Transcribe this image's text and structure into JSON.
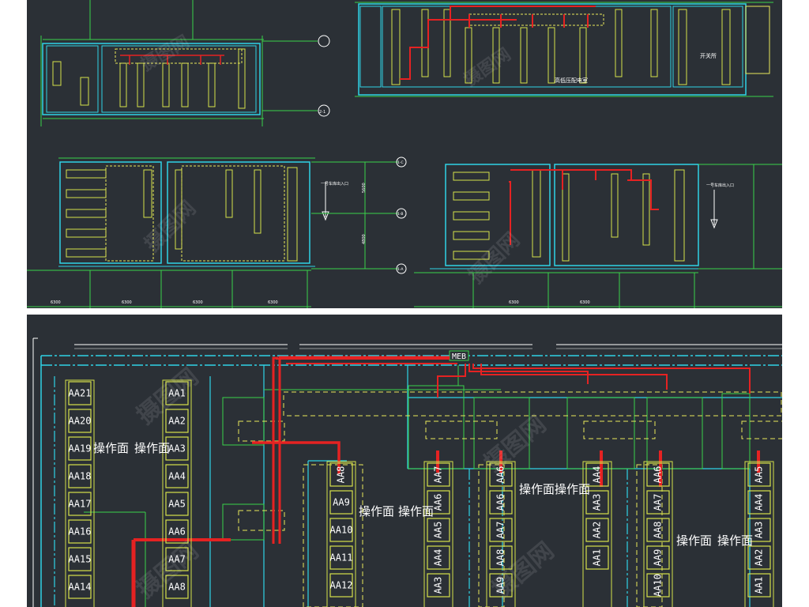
{
  "colors": {
    "background": "#2b3036",
    "wall": "#2fd3e6",
    "cabinet": "#d6e24a",
    "cable_tray": "#e52222",
    "dimension": "#39d24a",
    "dashed": "#e8e85a",
    "text": "#ffffff"
  },
  "top": {
    "axis_labels": [
      "2-1",
      "1-C",
      "1-B",
      "1-A"
    ],
    "dimension_labels": [
      "5600",
      "4800"
    ],
    "room_labels": [
      "高低压配电室",
      "开关所",
      "操作面"
    ],
    "entrance_labels": [
      "一号车库出入口",
      "一号车库出入口"
    ],
    "bottom_dimensions": [
      "6300",
      "6300",
      "6300",
      "6300",
      "6300",
      "6300"
    ]
  },
  "bottom": {
    "meb_label": "MEB",
    "col1_cabinets": [
      "AA21",
      "AA20",
      "AA19",
      "AA18",
      "AA17",
      "AA16",
      "AA15",
      "AA14"
    ],
    "col2_cabinets": [
      "AA1",
      "AA2",
      "AA3",
      "AA4",
      "AA5",
      "AA6",
      "AA7",
      "AA8"
    ],
    "col3_cabinets": [
      "AA8",
      "AA9",
      "AA10",
      "AA11",
      "AA12"
    ],
    "col4_cabinets": [
      "AA7",
      "AA6",
      "AA5",
      "AA4",
      "AA3"
    ],
    "col5_cabinets": [
      "AA6",
      "AA6",
      "AA7",
      "AA8",
      "AA9"
    ],
    "col6_cabinets": [
      "AA4",
      "AA3",
      "AA2",
      "AA1"
    ],
    "col7_cabinets": [
      "AA6",
      "AA7",
      "AA8",
      "AA9",
      "AA10"
    ],
    "col8_cabinets": [
      "AA5",
      "AA4",
      "AA3",
      "AA2",
      "AA1"
    ],
    "operation_face_labels": [
      "操作面",
      "操作面",
      "操作面",
      "操作面",
      "操作面",
      "操作面",
      "操作面",
      "操作面"
    ]
  }
}
